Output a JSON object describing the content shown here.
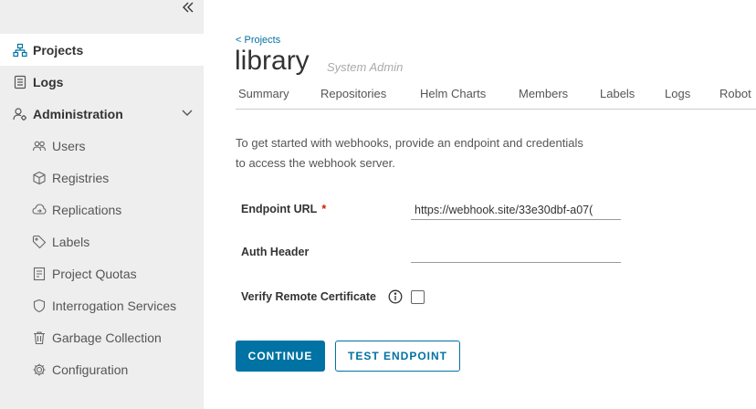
{
  "sidebar": {
    "collapse_icon": "double-chevron-left-icon",
    "items": [
      {
        "label": "Projects",
        "icon": "projects-icon"
      },
      {
        "label": "Logs",
        "icon": "logs-icon"
      },
      {
        "label": "Administration",
        "icon": "administration-icon"
      }
    ],
    "admin_items": [
      {
        "label": "Users",
        "icon": "users-icon"
      },
      {
        "label": "Registries",
        "icon": "registries-icon"
      },
      {
        "label": "Replications",
        "icon": "replications-icon"
      },
      {
        "label": "Labels",
        "icon": "labels-icon"
      },
      {
        "label": "Project Quotas",
        "icon": "quotas-icon"
      },
      {
        "label": "Interrogation Services",
        "icon": "shield-icon"
      },
      {
        "label": "Garbage Collection",
        "icon": "trash-icon"
      },
      {
        "label": "Configuration",
        "icon": "gear-icon"
      }
    ]
  },
  "header": {
    "back_link": "< Projects",
    "title": "library",
    "role": "System Admin"
  },
  "tabs": [
    "Summary",
    "Repositories",
    "Helm Charts",
    "Members",
    "Labels",
    "Logs",
    "Robot"
  ],
  "intro": {
    "line1": "To get started with webhooks, provide an endpoint and credentials",
    "line2": "to access the webhook server."
  },
  "form": {
    "endpoint_label": "Endpoint URL",
    "required_mark": "*",
    "endpoint_value": "https://webhook.site/33e30dbf-a07(",
    "auth_label": "Auth Header",
    "auth_value": "",
    "verify_label": "Verify Remote Certificate",
    "verify_checked": false
  },
  "buttons": {
    "continue": "CONTINUE",
    "test": "TEST ENDPOINT"
  },
  "colors": {
    "accent": "#0072a3",
    "required": "#c92100",
    "sidebar_bg": "#eeeeee"
  }
}
